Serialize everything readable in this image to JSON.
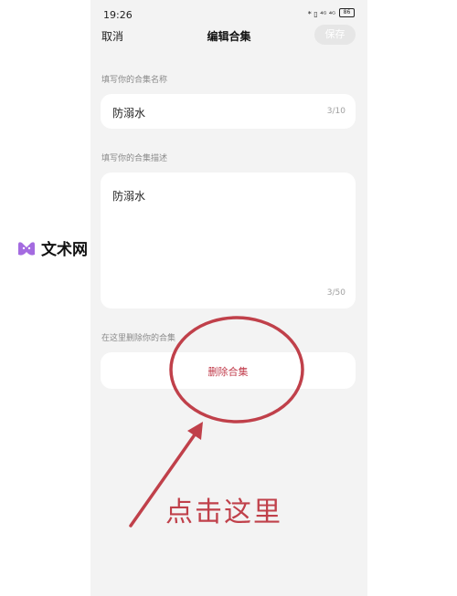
{
  "status_bar": {
    "time": "19:26",
    "signal_labels": "* ▯ ⁴ᴳ ⁴ᴳ",
    "battery": "86"
  },
  "header": {
    "cancel_label": "取消",
    "title": "编辑合集",
    "save_label": "保存"
  },
  "form": {
    "name_label": "填写你的合集名称",
    "name_value": "防溺水",
    "name_counter": "3/10",
    "desc_label": "填写你的合集描述",
    "desc_value": "防溺水",
    "desc_counter": "3/50",
    "delete_label": "在这里删除你的合集",
    "delete_button": "删除合集"
  },
  "watermark": {
    "text": "文术网"
  },
  "annotation": {
    "text": "点击这里",
    "color": "#c0404a"
  },
  "colors": {
    "background": "#f3f3f3",
    "card": "#ffffff",
    "delete_text": "#c03a4a",
    "save_disabled": "#e6e6e6"
  }
}
